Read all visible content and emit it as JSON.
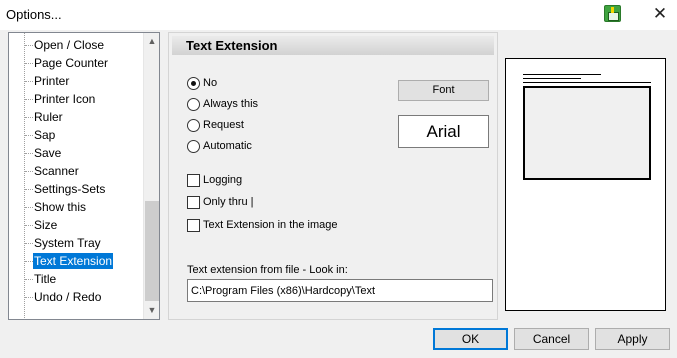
{
  "window": {
    "title": "Options..."
  },
  "tree": {
    "items": [
      "Open / Close",
      "Page Counter",
      "Printer",
      "Printer Icon",
      "Ruler",
      "Sap",
      "Save",
      "Scanner",
      "Settings-Sets",
      "Show this",
      "Size",
      "System Tray",
      "Text Extension",
      "Title",
      "Undo / Redo"
    ],
    "selected": "Text Extension"
  },
  "section": {
    "title": "Text Extension"
  },
  "radios": [
    {
      "label": "No",
      "checked": true
    },
    {
      "label": "Always this",
      "checked": false
    },
    {
      "label": "Request",
      "checked": false
    },
    {
      "label": "Automatic",
      "checked": false
    }
  ],
  "checkboxes": [
    {
      "label": "Logging",
      "checked": false
    },
    {
      "label": "Only thru |",
      "checked": false
    },
    {
      "label": "Text Extension in the image",
      "checked": false
    }
  ],
  "font": {
    "button_label": "Font",
    "preview": "Arial"
  },
  "path": {
    "label": "Text extension from file  -  Look in:",
    "value": "C:\\Program Files (x86)\\Hardcopy\\Text"
  },
  "buttons": {
    "ok": "OK",
    "cancel": "Cancel",
    "apply": "Apply"
  },
  "icons": {
    "close": "close-icon",
    "app": "app-icon"
  }
}
